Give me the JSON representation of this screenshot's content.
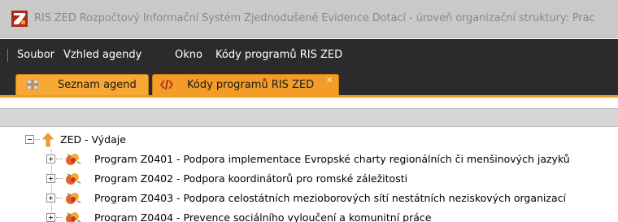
{
  "window": {
    "title": "RIS ZED Rozpočtový Informační Systém Zjednodušené Evidence Dotací - úroveň organizační struktury: Prac"
  },
  "menu": {
    "items": [
      {
        "label": "Soubor"
      },
      {
        "label": "Vzhled agendy"
      },
      {
        "label": "Okno"
      },
      {
        "label": "Kódy programů RIS ZED"
      }
    ]
  },
  "tabs": [
    {
      "label": "Seznam agend",
      "icon": "grid-icon"
    },
    {
      "label": "Kódy programů RIS ZED",
      "icon": "code-brackets-icon",
      "close": "×"
    }
  ],
  "tree": {
    "root": {
      "label": "ZED - Výdaje",
      "icon": "arrow-up-icon",
      "expanded": true
    },
    "children": [
      {
        "label": "Program Z0401 - Podpora implementace Evropské charty regionálních či menšinových jazyků",
        "icon": "flower-icon"
      },
      {
        "label": "Program Z0402 - Podpora koordinátorů pro romské záležitosti",
        "icon": "flower-icon"
      },
      {
        "label": "Program Z0403 - Podpora celostátních mezioborových sítí nestátních neziskových organizací",
        "icon": "flower-icon"
      },
      {
        "label": "Program Z0404 - Prevence sociálního vyloučení a komunitní práce",
        "icon": "flower-icon"
      }
    ]
  },
  "colors": {
    "accent_orange": "#f39c28",
    "menubar_bg": "#2b2b2b",
    "titlebar_bg": "#c9c9c9"
  }
}
